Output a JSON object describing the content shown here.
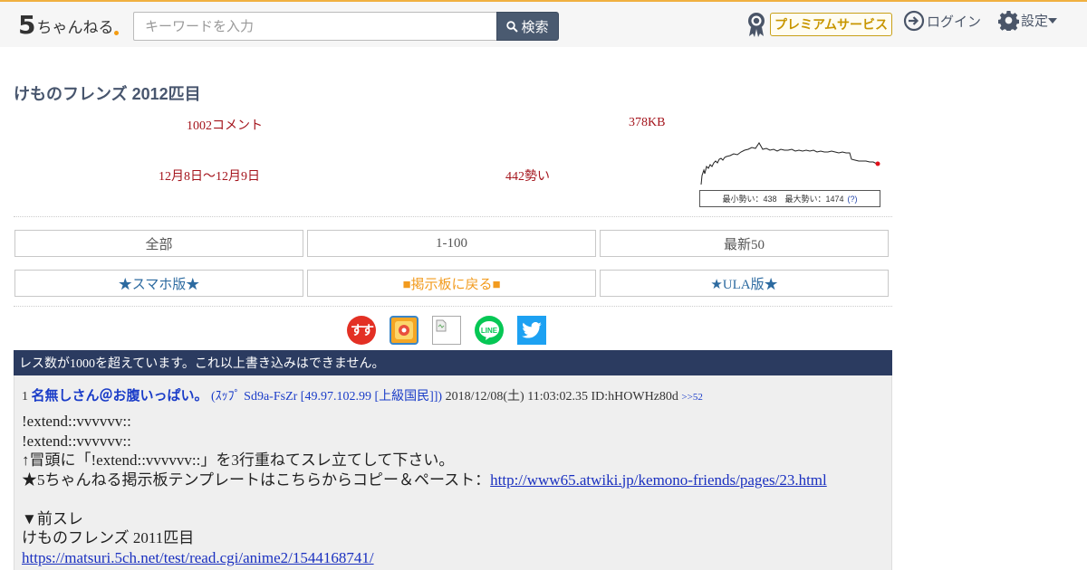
{
  "header": {
    "logo_text": "ちゃんねる",
    "logo_number": "5",
    "search_placeholder": "キーワードを入力",
    "search_button": "検索",
    "premium_label": "プレミアムサービス",
    "login_label": "ログイン",
    "settings_label": "設定"
  },
  "thread": {
    "title": "けものフレンズ 2012匹目",
    "comments": "1002コメント",
    "size": "378KB",
    "date_range": "12月8日〜12月9日",
    "speed": "442勢い",
    "graph_caption": "最小勢い：438　最大勢い：1474",
    "graph_help": "(?)"
  },
  "nav": {
    "all": "全部",
    "range": "1-100",
    "latest": "最新50",
    "smartphone": "★スマホ版★",
    "back_to_board": "■掲示板に戻る■",
    "ula": "★ULA版★"
  },
  "share_icons": [
    "matome-icon",
    "app-icon",
    "broken-image-icon",
    "line-icon",
    "twitter-icon"
  ],
  "share_text": {
    "matome": "すす",
    "line": "LINE"
  },
  "banner": "レス数が1000を超えています。これ以上書き込みはできません。",
  "post": {
    "number": "1",
    "name": "名無しさん＠お腹いっぱい。",
    "trip": "(ｽｯﾌﾟ Sd9a-FsZr [49.97.102.99 [上級国民]])",
    "date": "2018/12/08(土) 11:03:02.35",
    "id": "ID:hHOWHz80d",
    "ref": ">>52",
    "lines": {
      "l1": "!extend::vvvvvv::",
      "l2": "!extend::vvvvvv::",
      "l3": "↑冒頭に「!extend::vvvvvv::」を3行重ねてスレ立てして下さい。",
      "l4_text": "★5ちゃんねる掲示板テンプレートはこちらからコピー＆ペースト：",
      "l4_link": "http://www65.atwiki.jp/kemono-friends/pages/23.html",
      "l5": "▼前スレ",
      "l6": "けものフレンズ 2011匹目",
      "l7_link": "https://matsuri.5ch.net/test/read.cgi/anime2/1544168741/"
    }
  },
  "colors": {
    "accent_navy": "#2b3b60",
    "meta_red": "#a4141c",
    "name_blue": "#1a3cc8",
    "premium_gold": "#c89600",
    "orange": "#f29b1e"
  }
}
